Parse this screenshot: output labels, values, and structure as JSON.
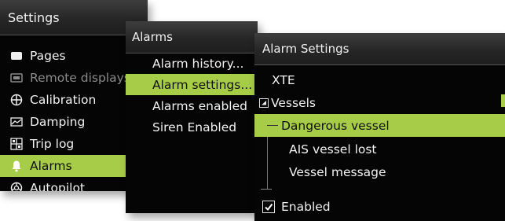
{
  "settings_panel": {
    "title": "Settings",
    "items": [
      {
        "label": "Pages"
      },
      {
        "label": "Remote displays"
      },
      {
        "label": "Calibration"
      },
      {
        "label": "Damping"
      },
      {
        "label": "Trip log"
      },
      {
        "label": "Alarms"
      },
      {
        "label": "Autopilot"
      }
    ]
  },
  "alarms_panel": {
    "title": "Alarms",
    "items": [
      {
        "label": "Alarm history..."
      },
      {
        "label": "Alarm settings..."
      },
      {
        "label": "Alarms enabled"
      },
      {
        "label": "Siren Enabled"
      }
    ]
  },
  "alarm_settings_panel": {
    "title": "Alarm Settings",
    "xte_label": "XTE",
    "vessels_label": "Vessels",
    "vessel_items": [
      {
        "label": "Dangerous vessel"
      },
      {
        "label": "AIS vessel lost"
      },
      {
        "label": "Vessel message"
      }
    ],
    "enabled_label": "Enabled"
  },
  "colors": {
    "accent": "#a7cd48",
    "panel_bg": "#050505",
    "header_bg": "#2a2a2a"
  }
}
